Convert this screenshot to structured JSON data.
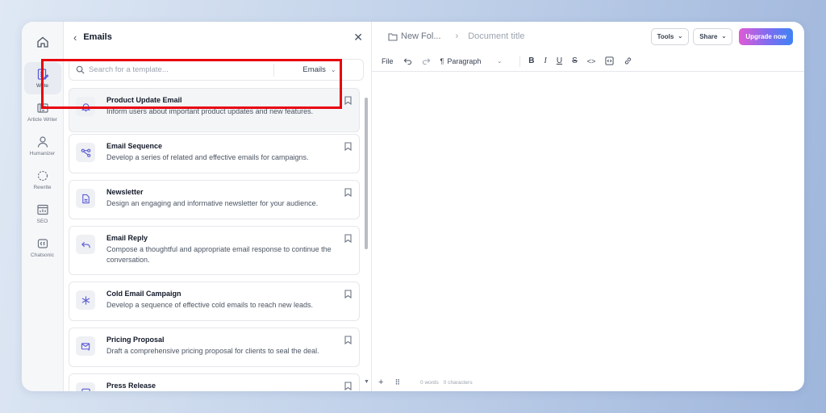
{
  "rail": {
    "items": [
      {
        "label": "Write",
        "icon": "write-icon"
      },
      {
        "label": "Article Writer",
        "icon": "article-icon"
      },
      {
        "label": "Humanizer",
        "icon": "person-icon"
      },
      {
        "label": "Rewrite",
        "icon": "rewrite-icon"
      },
      {
        "label": "SEO",
        "icon": "seo-icon"
      },
      {
        "label": "Chatsonic",
        "icon": "chatsonic-icon"
      }
    ]
  },
  "panel": {
    "title": "Emails",
    "search_placeholder": "Search for a template...",
    "filter_label": "Emails",
    "templates": [
      {
        "title": "Product Update Email",
        "desc": "Inform users about important product updates and new features.",
        "icon": "bell-icon"
      },
      {
        "title": "Email Sequence",
        "desc": "Develop a series of related and effective emails for campaigns.",
        "icon": "sequence-icon"
      },
      {
        "title": "Newsletter",
        "desc": "Design an engaging and informative newsletter for your audience.",
        "icon": "document-icon"
      },
      {
        "title": "Email Reply",
        "desc": "Compose a thoughtful and appropriate email response to continue the conversation.",
        "icon": "reply-icon"
      },
      {
        "title": "Cold Email Campaign",
        "desc": "Develop a sequence of effective cold emails to reach new leads.",
        "icon": "snowflake-icon"
      },
      {
        "title": "Pricing Proposal",
        "desc": "Draft a comprehensive pricing proposal for clients to seal the deal.",
        "icon": "mail-dollar-icon"
      },
      {
        "title": "Press Release",
        "desc": "",
        "icon": "press-icon"
      }
    ]
  },
  "editor": {
    "folder": "New Fol...",
    "doc_title": "Document title",
    "tools_label": "Tools",
    "share_label": "Share",
    "upgrade_label": "Upgrade now",
    "file_label": "File",
    "paragraph_label": "Paragraph",
    "words": "0 words",
    "characters": "0 characters"
  },
  "colors": {
    "highlight": "#e8000f",
    "icon_accent": "#5b5bd6"
  }
}
